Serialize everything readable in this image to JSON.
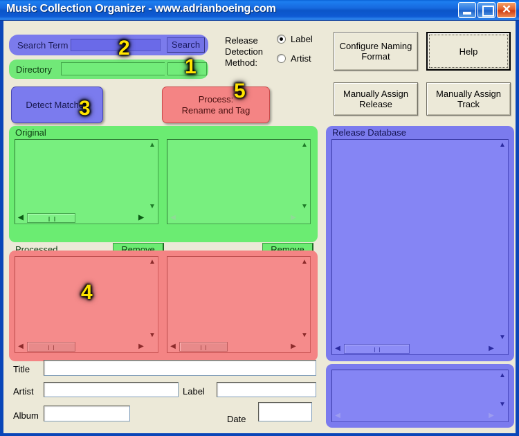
{
  "window": {
    "title": "Music Collection Organizer - www.adrianboeing.com",
    "controls": {
      "minimize": "minimize-button",
      "maximize": "maximize-button",
      "close": "close-button"
    }
  },
  "search": {
    "label": "Search Term",
    "value": "",
    "placeholder": "",
    "button": "Search"
  },
  "directory": {
    "label": "Directory",
    "value": "",
    "placeholder": "",
    "browse_button": "..."
  },
  "release_detection": {
    "label_line1": "Release",
    "label_line2": "Detection",
    "label_line3": "Method:",
    "options": [
      {
        "label": "Label",
        "selected": true
      },
      {
        "label": "Artist",
        "selected": false
      }
    ]
  },
  "right_buttons": {
    "configure_naming_format": "Configure Naming\nFormat",
    "configure_naming_format_line1": "Configure Naming",
    "configure_naming_format_line2": "Format",
    "help": "Help",
    "manually_assign_release_line1": "Manually Assign",
    "manually_assign_release_line2": "Release",
    "manually_assign_track_line1": "Manually Assign",
    "manually_assign_track_line2": "Track"
  },
  "actions": {
    "detect_matches": "Detect Matches",
    "process_line1": "Process:",
    "process_line2": "Rename and Tag"
  },
  "panels": {
    "original": {
      "title": "Original",
      "left_list_items": [],
      "right_list_items": [],
      "remove_left": "Remove",
      "remove_right": "Remove"
    },
    "processed": {
      "title": "Processed",
      "left_list_items": [],
      "right_list_items": []
    },
    "release_database": {
      "title": "Release Database",
      "list_items": [],
      "detail_items": []
    }
  },
  "form": {
    "title": {
      "label": "Title",
      "value": ""
    },
    "artist": {
      "label": "Artist",
      "value": ""
    },
    "label": {
      "label": "Label",
      "value": ""
    },
    "album": {
      "label": "Album",
      "value": ""
    },
    "date": {
      "label": "Date",
      "value": ""
    }
  },
  "annotations": [
    {
      "number": "1",
      "target": "directory-browse-button"
    },
    {
      "number": "2",
      "target": "search-term-input"
    },
    {
      "number": "3",
      "target": "detect-matches-button"
    },
    {
      "number": "4",
      "target": "processed-left-list"
    },
    {
      "number": "5",
      "target": "process-rename-tag-button"
    }
  ],
  "colors": {
    "titlebar_blue": "#1669df",
    "client_bg": "#ece9d8",
    "green_panel": "#6bec72",
    "red_panel": "#f48484",
    "blue_panel": "#7b7bee",
    "annotation_yellow": "#ffe400"
  }
}
